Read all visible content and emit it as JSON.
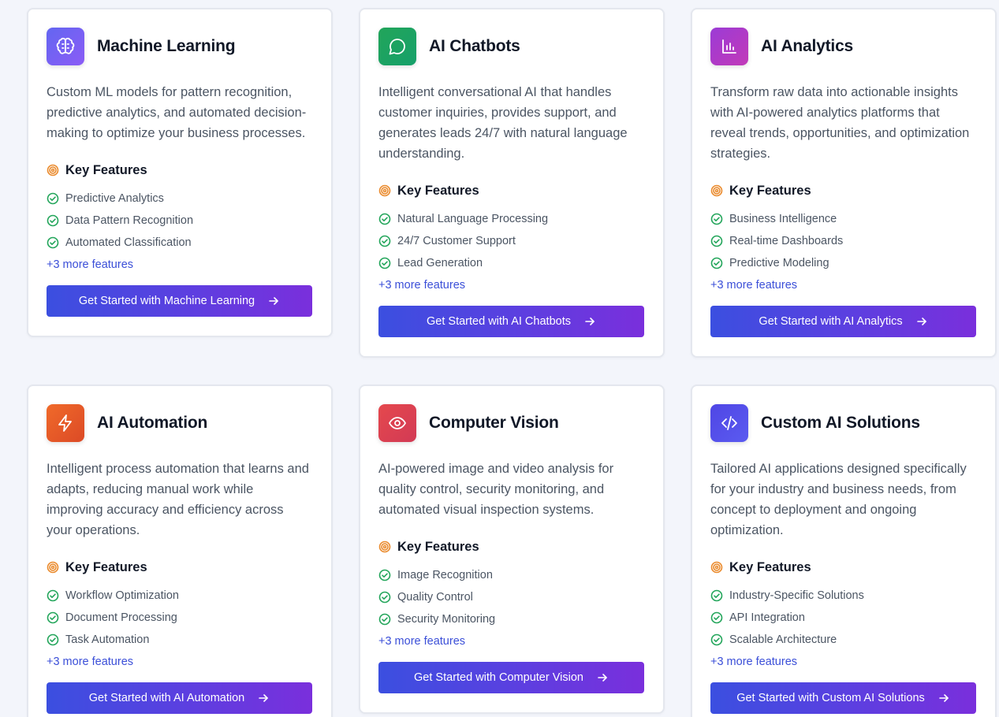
{
  "key_features_label": "Key Features",
  "cards": [
    {
      "title": "Machine Learning",
      "icon": "brain-icon",
      "icon_gradient": [
        "#6366f1",
        "#8b5cf6"
      ],
      "description": "Custom ML models for pattern recognition, predictive analytics, and automated decision-making to optimize your business processes.",
      "features": [
        "Predictive Analytics",
        "Data Pattern Recognition",
        "Automated Classification"
      ],
      "more": "+3 more features",
      "cta": "Get Started with Machine Learning"
    },
    {
      "title": "AI Chatbots",
      "icon": "chat-bubble-icon",
      "icon_gradient": [
        "#22a55a",
        "#16a06a"
      ],
      "description": "Intelligent conversational AI that handles customer inquiries, provides support, and generates leads 24/7 with natural language understanding.",
      "features": [
        "Natural Language Processing",
        "24/7 Customer Support",
        "Lead Generation"
      ],
      "more": "+3 more features",
      "cta": "Get Started with AI Chatbots"
    },
    {
      "title": "AI Analytics",
      "icon": "bar-chart-icon",
      "icon_gradient": [
        "#9b3bd6",
        "#c23ab8"
      ],
      "description": "Transform raw data into actionable insights with AI-powered analytics platforms that reveal trends, opportunities, and optimization strategies.",
      "features": [
        "Business Intelligence",
        "Real-time Dashboards",
        "Predictive Modeling"
      ],
      "more": "+3 more features",
      "cta": "Get Started with AI Analytics"
    },
    {
      "title": "AI Automation",
      "icon": "lightning-icon",
      "icon_gradient": [
        "#f06a2a",
        "#dc4a26"
      ],
      "description": "Intelligent process automation that learns and adapts, reducing manual work while improving accuracy and efficiency across your operations.",
      "features": [
        "Workflow Optimization",
        "Document Processing",
        "Task Automation"
      ],
      "more": "+3 more features",
      "cta": "Get Started with AI Automation"
    },
    {
      "title": "Computer Vision",
      "icon": "eye-icon",
      "icon_gradient": [
        "#e5484d",
        "#d23a55"
      ],
      "description": "AI-powered image and video analysis for quality control, security monitoring, and automated visual inspection systems.",
      "features": [
        "Image Recognition",
        "Quality Control",
        "Security Monitoring"
      ],
      "more": "+3 more features",
      "cta": "Get Started with Computer Vision"
    },
    {
      "title": "Custom AI Solutions",
      "icon": "code-icon",
      "icon_gradient": [
        "#4f46e5",
        "#5b5bf0"
      ],
      "description": "Tailored AI applications designed specifically for your industry and business needs, from concept to deployment and ongoing optimization.",
      "features": [
        "Industry-Specific Solutions",
        "API Integration",
        "Scalable Architecture"
      ],
      "more": "+3 more features",
      "cta": "Get Started with Custom AI Solutions"
    }
  ]
}
